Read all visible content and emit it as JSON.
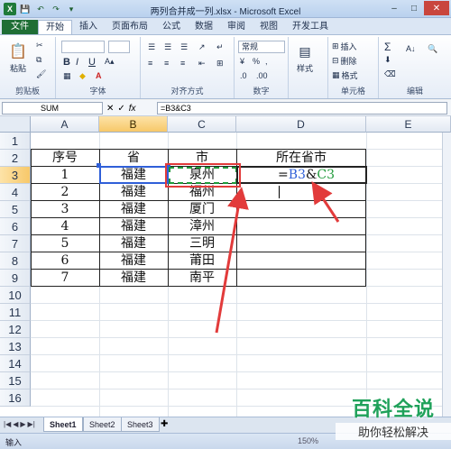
{
  "window": {
    "title": "两列合并成一列.xlsx - Microsoft Excel",
    "app_icon": "X",
    "controls": [
      "–",
      "□",
      "✕"
    ]
  },
  "ribbon_tabs": [
    "文件",
    "开始",
    "插入",
    "页面布局",
    "公式",
    "数据",
    "审阅",
    "视图",
    "开发工具"
  ],
  "ribbon": {
    "groups": [
      "剪贴板",
      "字体",
      "对齐方式",
      "数字",
      "单元格",
      "编辑"
    ],
    "paste_label": "粘贴",
    "font_bold": "B",
    "font_italic": "I",
    "font_underline": "U",
    "number_format": "常规",
    "style_label": "样式",
    "insert_label": "插入",
    "delete_label": "删除",
    "format_label": "格式",
    "sum_icon": "Σ",
    "sort_icon": "A↓"
  },
  "formula_bar": {
    "name_box": "SUM",
    "cancel_icon": "✕",
    "enter_icon": "✓",
    "fx_label": "fx",
    "formula": "=B3&C3"
  },
  "columns": [
    "A",
    "B",
    "C",
    "D",
    "E"
  ],
  "rows": [
    "1",
    "2",
    "3",
    "4",
    "5",
    "6",
    "7",
    "8",
    "9",
    "10",
    "11",
    "12",
    "13",
    "14",
    "15",
    "16"
  ],
  "table": {
    "headers": [
      "序号",
      "省",
      "市",
      "所在省市"
    ],
    "rows": [
      [
        "1",
        "福建",
        "泉州"
      ],
      [
        "2",
        "福建",
        "福州"
      ],
      [
        "3",
        "福建",
        "厦门"
      ],
      [
        "4",
        "福建",
        "漳州"
      ],
      [
        "5",
        "福建",
        "三明"
      ],
      [
        "6",
        "福建",
        "莆田"
      ],
      [
        "7",
        "福建",
        "南平"
      ]
    ],
    "editing_cell": {
      "prefix": "=",
      "ref1": "B3",
      "amp": "&",
      "ref2": "C3",
      "ref1_color": "#2f5fd8",
      "ref2_color": "#1f9a3a"
    }
  },
  "sheets": [
    "Sheet1",
    "Sheet2",
    "Sheet3"
  ],
  "status": {
    "mode": "输入",
    "zoom": "150%"
  },
  "watermark": {
    "title": "百科全说",
    "subtitle": "助你轻松解决"
  }
}
